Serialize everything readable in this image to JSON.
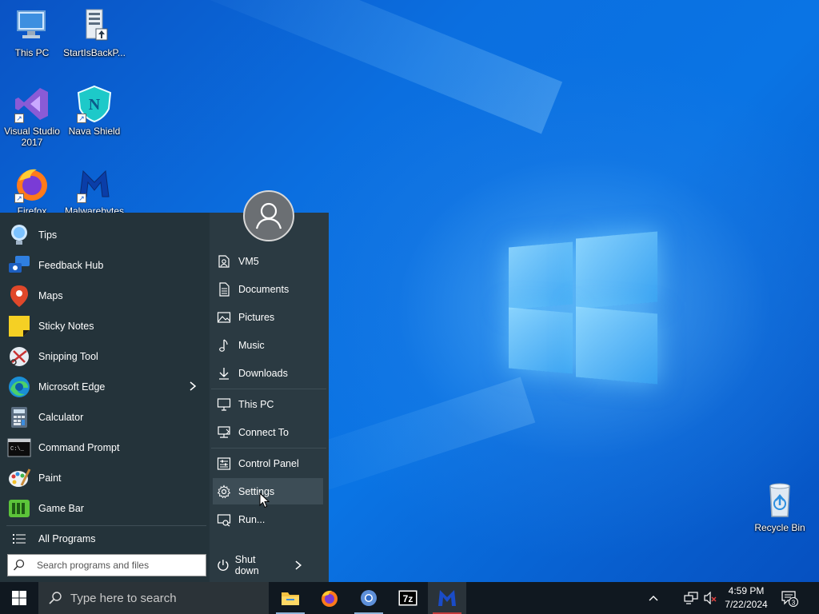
{
  "desktop": {
    "icons": [
      {
        "label": "This PC"
      },
      {
        "label": "StartIsBackP..."
      },
      {
        "label": "Visual Studio 2017"
      },
      {
        "label": "Nava Shield"
      },
      {
        "label": "Firefox"
      },
      {
        "label": "Malwarebytes"
      },
      {
        "label": "Recycle Bin"
      }
    ]
  },
  "start_menu": {
    "apps": [
      {
        "label": "Tips",
        "icon": "tips-icon"
      },
      {
        "label": "Feedback Hub",
        "icon": "feedback-hub-icon"
      },
      {
        "label": "Maps",
        "icon": "maps-icon"
      },
      {
        "label": "Sticky Notes",
        "icon": "sticky-notes-icon"
      },
      {
        "label": "Snipping Tool",
        "icon": "snipping-tool-icon"
      },
      {
        "label": "Microsoft Edge",
        "icon": "edge-icon"
      },
      {
        "label": "Calculator",
        "icon": "calculator-icon"
      },
      {
        "label": "Command Prompt",
        "icon": "command-prompt-icon"
      },
      {
        "label": "Paint",
        "icon": "paint-icon"
      },
      {
        "label": "Game Bar",
        "icon": "game-bar-icon"
      }
    ],
    "all_programs": "All Programs",
    "search_placeholder": "Search programs and files",
    "right_items": [
      {
        "label": "VM5"
      },
      {
        "label": "Documents"
      },
      {
        "label": "Pictures"
      },
      {
        "label": "Music"
      },
      {
        "label": "Downloads"
      },
      {
        "label": "This PC"
      },
      {
        "label": "Connect To"
      },
      {
        "label": "Control Panel"
      },
      {
        "label": "Settings"
      },
      {
        "label": "Run..."
      }
    ],
    "shutdown_label": "Shut down"
  },
  "taskbar": {
    "search_placeholder": "Type here to search",
    "pinned": [
      "file-explorer-icon",
      "firefox-icon",
      "chromium-icon",
      "7zip-icon",
      "malwarebytes-icon"
    ],
    "time": "4:59 PM",
    "date": "7/22/2024",
    "notification_count": "3"
  }
}
